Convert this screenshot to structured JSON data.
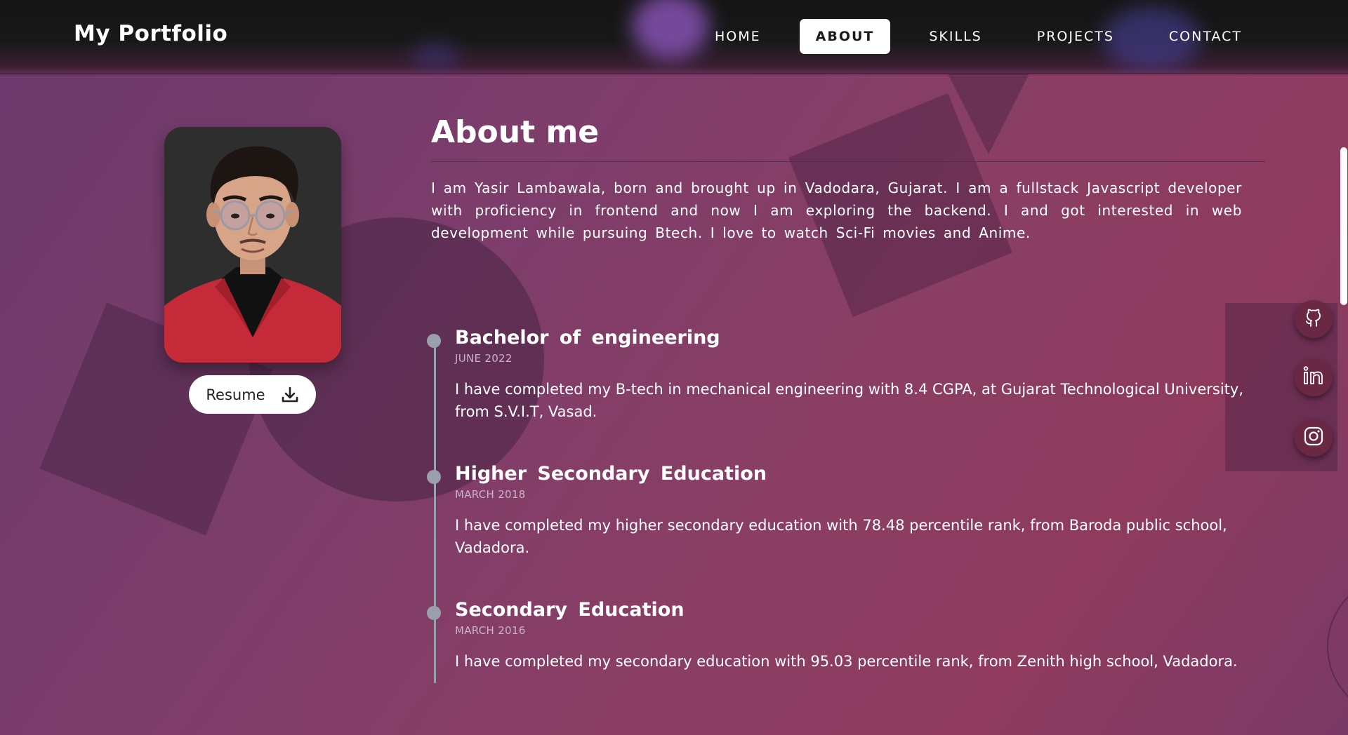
{
  "header": {
    "logo": "My Portfolio",
    "nav": [
      "HOME",
      "ABOUT",
      "SKILLS",
      "PROJECTS",
      "CONTACT"
    ],
    "active": "ABOUT"
  },
  "profile": {
    "resume_label": "Resume",
    "photo_icon": "profile-photo"
  },
  "about": {
    "title": "About me",
    "text": "I am Yasir Lambawala, born and brought up in Vadodara, Gujarat. I am a fullstack Javascript developer with proficiency in frontend and now I am exploring the backend. I and got interested in web development while pursuing Btech. I love to watch Sci-Fi movies and Anime."
  },
  "timeline": [
    {
      "title": "Bachelor of engineering",
      "date": "JUNE 2022",
      "description": "I have completed my B-tech in mechanical engineering with 8.4 CGPA, at Gujarat Technological University, from S.V.I.T, Vasad."
    },
    {
      "title": "Higher Secondary Education",
      "date": "MARCH 2018",
      "description": "I have completed my higher secondary education with 78.48 percentile rank, from Baroda public school, Vadadora."
    },
    {
      "title": "Secondary Education",
      "date": "MARCH 2016",
      "description": "I have completed my secondary education with 95.03 percentile rank, from Zenith high school, Vadadora."
    }
  ],
  "social": [
    "github-icon",
    "linkedin-icon",
    "instagram-icon"
  ],
  "colors": {
    "header_bg": "#151515",
    "page_gradient_start": "#6a3a6c",
    "page_gradient_end": "#8e3b5e",
    "timeline": "#9aa0ab",
    "social_bg": "#6a2845"
  }
}
